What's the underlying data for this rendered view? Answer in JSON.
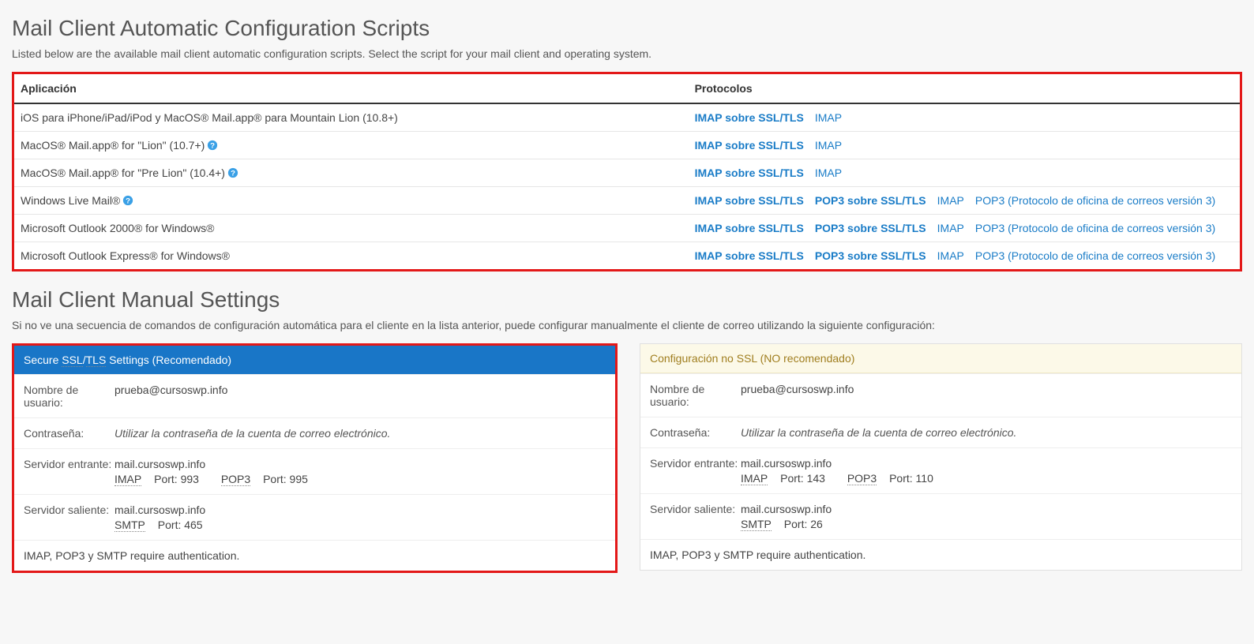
{
  "section1": {
    "title": "Mail Client Automatic Configuration Scripts",
    "subtitle": "Listed below are the available mail client automatic configuration scripts. Select the script for your mail client and operating system.",
    "col_app": "Aplicación",
    "col_proto": "Protocolos"
  },
  "rows": [
    {
      "app": "iOS para iPhone/iPad/iPod y MacOS® Mail.app® para Mountain Lion (10.8+)",
      "help": false,
      "protos": [
        {
          "t": "IMAP sobre SSL/TLS",
          "b": true
        },
        {
          "t": "IMAP",
          "b": false
        }
      ]
    },
    {
      "app": "MacOS® Mail.app® for \"Lion\" (10.7+)",
      "help": true,
      "protos": [
        {
          "t": "IMAP sobre SSL/TLS",
          "b": true
        },
        {
          "t": "IMAP",
          "b": false
        }
      ]
    },
    {
      "app": "MacOS® Mail.app® for \"Pre Lion\" (10.4+)",
      "help": true,
      "protos": [
        {
          "t": "IMAP sobre SSL/TLS",
          "b": true
        },
        {
          "t": "IMAP",
          "b": false
        }
      ]
    },
    {
      "app": "Windows Live Mail®",
      "help": true,
      "protos": [
        {
          "t": "IMAP sobre SSL/TLS",
          "b": true
        },
        {
          "t": "POP3 sobre SSL/TLS",
          "b": true
        },
        {
          "t": "IMAP",
          "b": false
        },
        {
          "t": "POP3 (Protocolo de oficina de correos versión 3)",
          "b": false
        }
      ]
    },
    {
      "app": "Microsoft Outlook 2000® for Windows®",
      "help": false,
      "protos": [
        {
          "t": "IMAP sobre SSL/TLS",
          "b": true
        },
        {
          "t": "POP3 sobre SSL/TLS",
          "b": true
        },
        {
          "t": "IMAP",
          "b": false
        },
        {
          "t": "POP3 (Protocolo de oficina de correos versión 3)",
          "b": false
        }
      ]
    },
    {
      "app": "Microsoft Outlook Express® for Windows®",
      "help": false,
      "protos": [
        {
          "t": "IMAP sobre SSL/TLS",
          "b": true
        },
        {
          "t": "POP3 sobre SSL/TLS",
          "b": true
        },
        {
          "t": "IMAP",
          "b": false
        },
        {
          "t": "POP3 (Protocolo de oficina de correos versión 3)",
          "b": false
        }
      ]
    }
  ],
  "section2": {
    "title": "Mail Client Manual Settings",
    "subtitle": "Si no ve una secuencia de comandos de configuración automática para el cliente en la lista anterior, puede configurar manualmente el cliente de correo utilizando la siguiente configuración:"
  },
  "ssl": {
    "header_pre": "Secure ",
    "header_abbr1": "SSL",
    "header_sep": "/",
    "header_abbr2": "TLS",
    "header_post": " Settings (Recomendado)",
    "user_label": "Nombre de usuario:",
    "user_value": "prueba@cursoswp.info",
    "pass_label": "Contraseña:",
    "pass_value": "Utilizar la contraseña de la cuenta de correo electrónico.",
    "in_label": "Servidor entrante:",
    "in_server": "mail.cursoswp.info",
    "in_imap_abbr": "IMAP",
    "in_imap_port": " Port: 993",
    "in_pop_abbr": "POP3",
    "in_pop_port": " Port: 995",
    "out_label": "Servidor saliente:",
    "out_server": "mail.cursoswp.info",
    "out_abbr": "SMTP",
    "out_port": " Port: 465",
    "footer": "IMAP, POP3 y SMTP require authentication."
  },
  "nonssl": {
    "header": "Configuración no SSL (NO recomendado)",
    "user_label": "Nombre de usuario:",
    "user_value": "prueba@cursoswp.info",
    "pass_label": "Contraseña:",
    "pass_value": "Utilizar la contraseña de la cuenta de correo electrónico.",
    "in_label": "Servidor entrante:",
    "in_server": "mail.cursoswp.info",
    "in_imap_abbr": "IMAP",
    "in_imap_port": " Port: 143",
    "in_pop_abbr": "POP3",
    "in_pop_port": " Port: 110",
    "out_label": "Servidor saliente:",
    "out_server": "mail.cursoswp.info",
    "out_abbr": "SMTP",
    "out_port": " Port: 26",
    "footer": "IMAP, POP3 y SMTP require authentication."
  }
}
